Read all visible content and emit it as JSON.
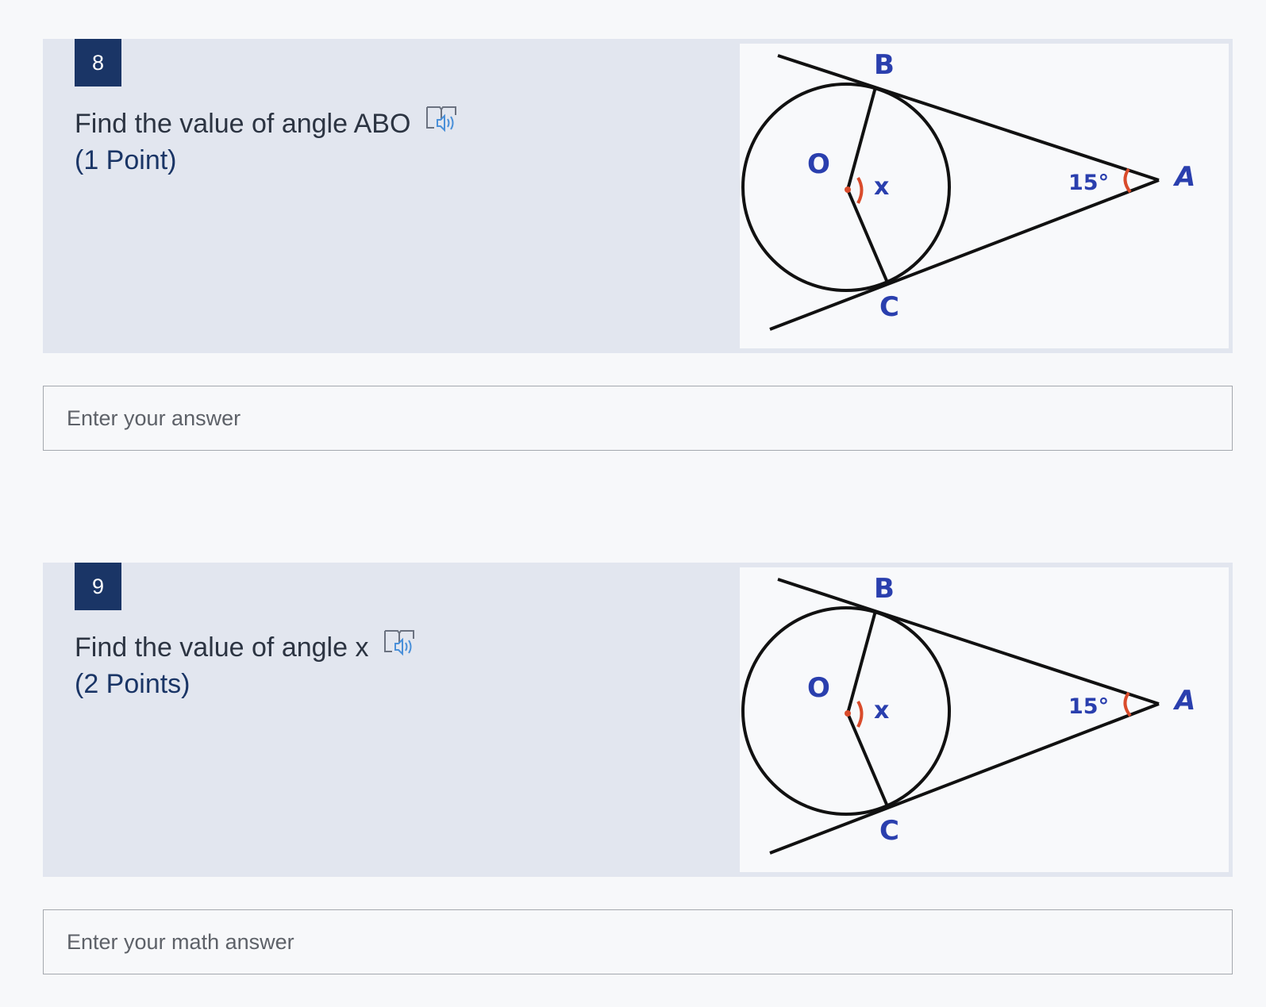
{
  "questions": [
    {
      "number": "8",
      "prompt": "Find the value of angle ABO",
      "points": "(1 Point)",
      "answer_placeholder": "Enter your answer",
      "figure": {
        "labels": {
          "b": "B",
          "o": "O",
          "x": "x",
          "angle": "15°",
          "a": "A",
          "c": "C"
        }
      }
    },
    {
      "number": "9",
      "prompt": "Find the value of angle x",
      "points": "(2 Points)",
      "answer_placeholder": "Enter your math answer",
      "figure": {
        "labels": {
          "b": "B",
          "o": "O",
          "x": "x",
          "angle": "15°",
          "a": "A",
          "c": "C"
        }
      }
    }
  ],
  "colors": {
    "number_badge": "#1a3566",
    "question_panel": "#e2e6ef",
    "figure_label_blue": "#2a3fae",
    "angle_mark_red": "#d94b2b",
    "reader_icon_blue": "#4a90d9"
  },
  "icons": {
    "reader": "immersive-reader-icon"
  }
}
